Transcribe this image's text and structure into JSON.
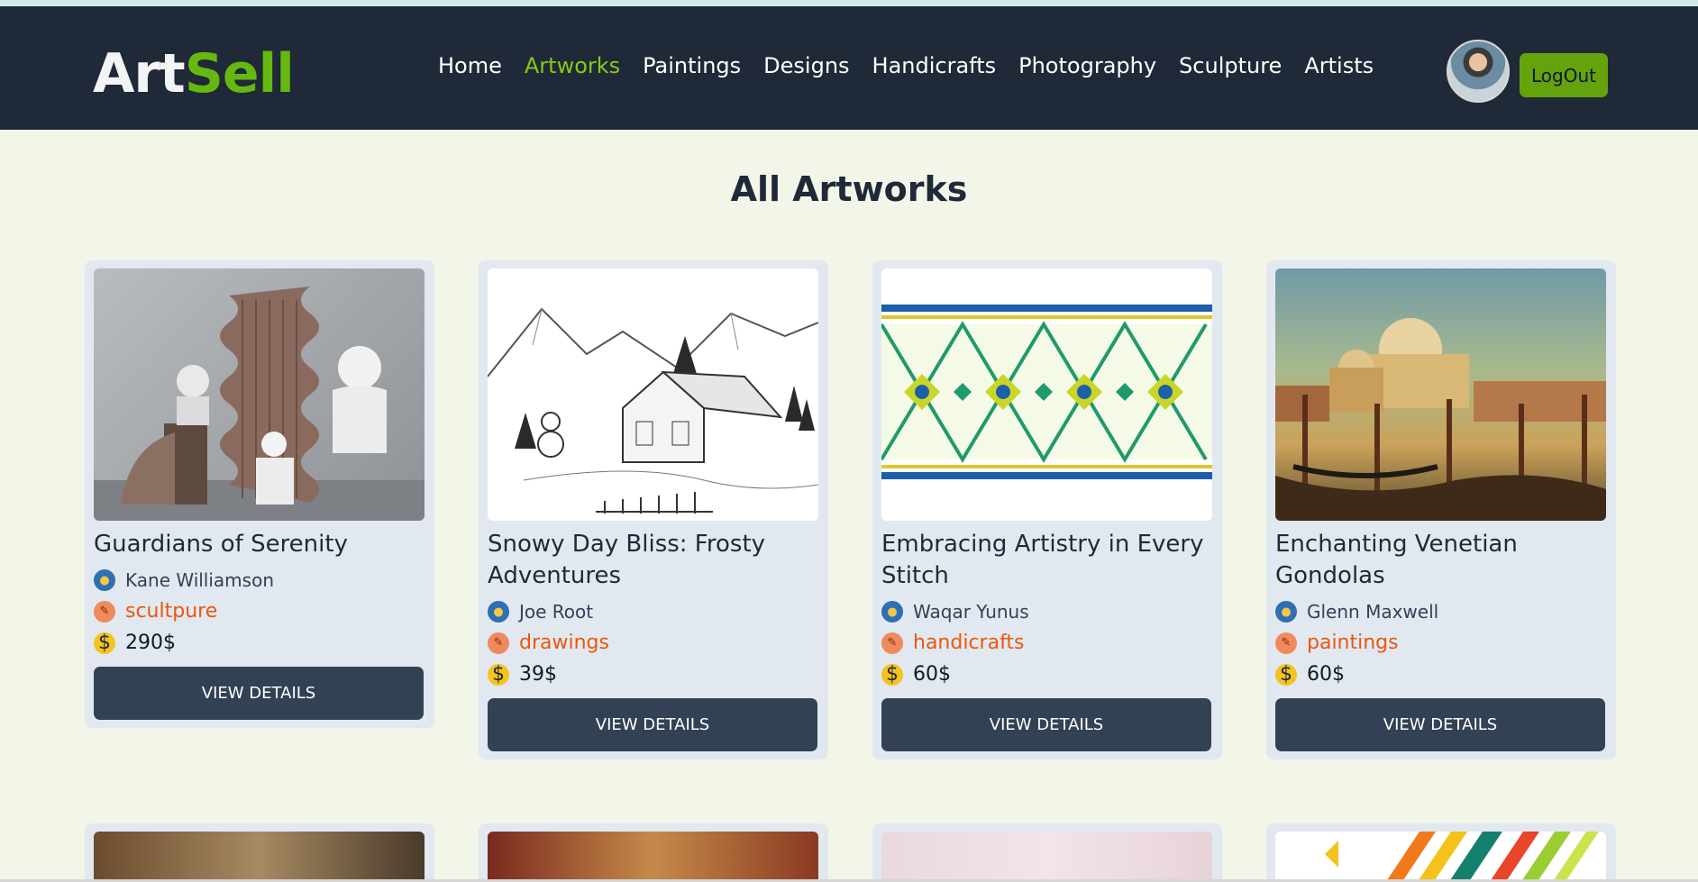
{
  "header": {
    "logo_part1": "Art",
    "logo_part2": "Sell",
    "nav": [
      {
        "label": "Home",
        "active": false
      },
      {
        "label": "Artworks",
        "active": true
      },
      {
        "label": "Paintings",
        "active": false
      },
      {
        "label": "Designs",
        "active": false
      },
      {
        "label": "Handicrafts",
        "active": false
      },
      {
        "label": "Photography",
        "active": false
      },
      {
        "label": "Sculpture",
        "active": false
      },
      {
        "label": "Artists",
        "active": false
      }
    ],
    "logout_label": "LogOut"
  },
  "main": {
    "title": "All Artworks",
    "cards": [
      {
        "title": "Guardians of Serenity",
        "artist": "Kane Williamson",
        "category": "scultpure",
        "price": "290$",
        "button": "View Details"
      },
      {
        "title": "Snowy Day Bliss: Frosty Adventures",
        "artist": "Joe Root",
        "category": "drawings",
        "price": "39$",
        "button": "View Details"
      },
      {
        "title": "Embracing Artistry in Every Stitch",
        "artist": "Waqar Yunus",
        "category": "handicrafts",
        "price": "60$",
        "button": "View Details"
      },
      {
        "title": "Enchanting Venetian Gondolas",
        "artist": "Glenn Maxwell",
        "category": "paintings",
        "price": "60$",
        "button": "View Details"
      }
    ]
  },
  "colors": {
    "nav_bg": "#1f2937",
    "accent_green": "#65a30d",
    "page_bg": "#f1f6e9",
    "card_bg": "#e2e8f0",
    "category_orange": "#ea580c",
    "button_bg": "#334155"
  },
  "icons": {
    "artist": "artist-badge-icon",
    "category": "palette-icon",
    "price": "coin-icon"
  }
}
